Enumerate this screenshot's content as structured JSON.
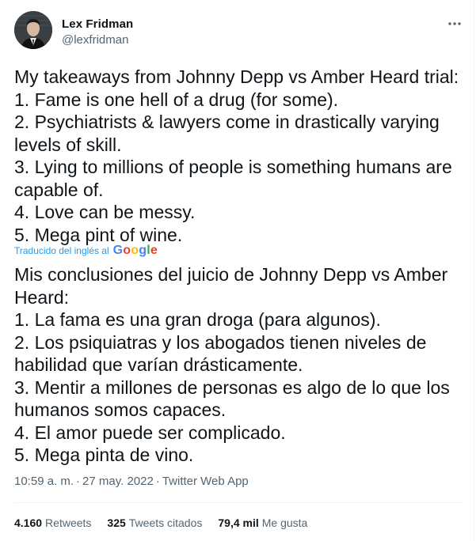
{
  "author": {
    "display_name": "Lex Fridman",
    "handle": "@lexfridman"
  },
  "more_icon": "more-horizontal-icon",
  "tweet": {
    "text": "My takeaways from Johnny Depp vs Amber Heard trial:\n1. Fame is one hell of a drug (for some).\n2. Psychiatrists & lawyers come in drastically varying levels of skill.\n3. Lying to millions of people is something humans are capable of.\n4. Love can be messy.\n5. Mega pint of wine.",
    "translated_label": "Traducido del inglés al",
    "translation_provider": "Google",
    "translation": "Mis conclusiones del juicio de Johnny Depp vs Amber Heard:\n 1. La fama es una gran droga (para algunos).\n 2. Los psiquiatras y los abogados tienen niveles de habilidad que varían drásticamente.\n 3. Mentir a millones de personas es algo de lo que los humanos somos capaces.\n 4. El amor puede ser complicado.\n 5. Mega pinta de vino."
  },
  "meta": {
    "time": "10:59 a. m.",
    "date": "27 may. 2022",
    "source": "Twitter Web App",
    "separator": "·"
  },
  "stats": {
    "retweets_count": "4.160",
    "retweets_label": "Retweets",
    "quotes_count": "325",
    "quotes_label": "Tweets citados",
    "likes_count": "79,4 mil",
    "likes_label": "Me gusta"
  },
  "colors": {
    "text": "#0f1419",
    "secondary": "#536471",
    "link": "#1d9bf0",
    "divider": "#eff3f4"
  }
}
